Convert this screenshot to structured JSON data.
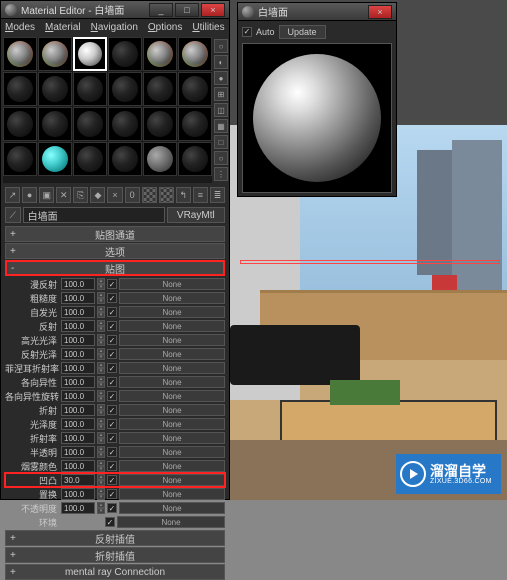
{
  "material_editor": {
    "title": "Material Editor - 白墙面",
    "menus": [
      "Modes",
      "Material",
      "Navigation",
      "Options",
      "Utilities"
    ],
    "material_name": "白墙面",
    "material_type": "VRayMtl",
    "channel_label": "贴图通道",
    "rollouts": {
      "options": "选项",
      "maps": "贴图",
      "refl_interp": "反射插值",
      "refr_interp": "折射插值",
      "mental_ray": "mental ray Connection"
    },
    "map_rows": [
      {
        "label": "漫反射",
        "value": "100.0",
        "checked": true,
        "slot": "None"
      },
      {
        "label": "粗糙度",
        "value": "100.0",
        "checked": true,
        "slot": "None"
      },
      {
        "label": "自发光",
        "value": "100.0",
        "checked": true,
        "slot": "None"
      },
      {
        "label": "反射",
        "value": "100.0",
        "checked": true,
        "slot": "None"
      },
      {
        "label": "高光光泽",
        "value": "100.0",
        "checked": true,
        "slot": "None"
      },
      {
        "label": "反射光泽",
        "value": "100.0",
        "checked": true,
        "slot": "None"
      },
      {
        "label": "菲涅耳折射率",
        "value": "100.0",
        "checked": true,
        "slot": "None"
      },
      {
        "label": "各向异性",
        "value": "100.0",
        "checked": true,
        "slot": "None"
      },
      {
        "label": "各向异性旋转",
        "value": "100.0",
        "checked": true,
        "slot": "None"
      },
      {
        "label": "折射",
        "value": "100.0",
        "checked": true,
        "slot": "None"
      },
      {
        "label": "光泽度",
        "value": "100.0",
        "checked": true,
        "slot": "None"
      },
      {
        "label": "折射率",
        "value": "100.0",
        "checked": true,
        "slot": "None"
      },
      {
        "label": "半透明",
        "value": "100.0",
        "checked": true,
        "slot": "None"
      },
      {
        "label": "烟雾颜色",
        "value": "100.0",
        "checked": true,
        "slot": "None"
      },
      {
        "label": "凹凸",
        "value": "30.0",
        "checked": true,
        "slot": "None"
      },
      {
        "label": "置换",
        "value": "100.0",
        "checked": true,
        "slot": "None"
      },
      {
        "label": "不透明度",
        "value": "100.0",
        "checked": true,
        "slot": "None"
      },
      {
        "label": "环境",
        "value": "",
        "checked": true,
        "slot": "None"
      }
    ]
  },
  "preview": {
    "title": "白墙面",
    "auto_label": "Auto",
    "update_label": "Update"
  },
  "watermark": {
    "brand": "溜溜自学",
    "url": "ZIXUE.3D66.COM"
  },
  "win_controls": {
    "minimize": "_",
    "maximize": "□",
    "close": "×"
  },
  "tool_icons": [
    "eyedrop",
    "sphere",
    "assign",
    "reset",
    "put",
    "make",
    "cross",
    "show",
    "pattern",
    "pattern",
    "arrow",
    "list",
    "list"
  ],
  "side_icons": [
    "○",
    "◐",
    "●",
    "⊞",
    "◫",
    "▦",
    "□",
    "○",
    "⋮"
  ]
}
